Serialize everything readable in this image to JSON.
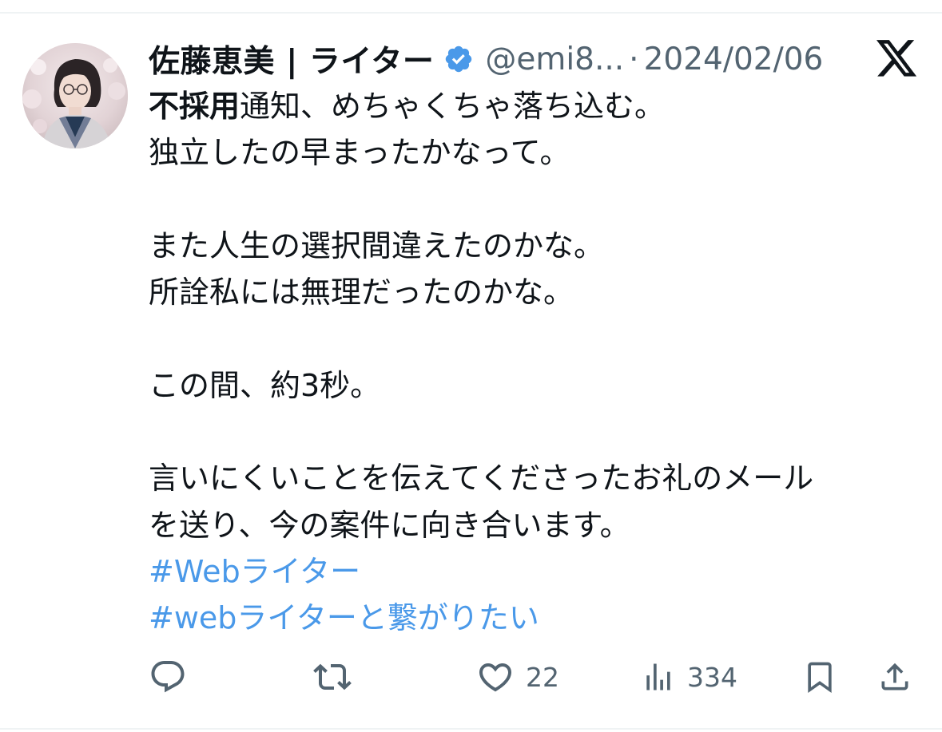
{
  "tweet": {
    "display_name": "佐藤恵美 | ライター",
    "handle": "@emi8...",
    "separator": "·",
    "date": "2024/02/06",
    "lines": [
      {
        "bold": "不採用",
        "text": "通知、めちゃくちゃ落ち込む。"
      },
      {
        "bold": "",
        "text": "独立したの早まったかなって。"
      },
      {
        "bold": "",
        "text": ""
      },
      {
        "bold": "",
        "text": "また人生の選択間違えたのかな。"
      },
      {
        "bold": "",
        "text": "所詮私には無理だったのかな。"
      },
      {
        "bold": "",
        "text": ""
      },
      {
        "bold": "",
        "text": "この間、約3秒。"
      },
      {
        "bold": "",
        "text": ""
      },
      {
        "bold": "",
        "text": "言いにくいことを伝えてくださったお礼のメール"
      },
      {
        "bold": "",
        "text": "を送り、今の案件に向き合います。"
      }
    ],
    "hashtags": [
      "#Webライター",
      "#webライターと繋がりたい"
    ]
  },
  "actions": {
    "reply_icon": "reply-icon",
    "retweet_icon": "retweet-icon",
    "like_icon": "heart-icon",
    "like_count": "22",
    "views_icon": "views-icon",
    "views_count": "334",
    "bookmark_icon": "bookmark-icon",
    "share_icon": "share-icon"
  },
  "colors": {
    "text": "#0f1419",
    "muted": "#536471",
    "hashtag": "#4a99e9",
    "verified": "#4a99e9",
    "border": "#eff3f4"
  }
}
